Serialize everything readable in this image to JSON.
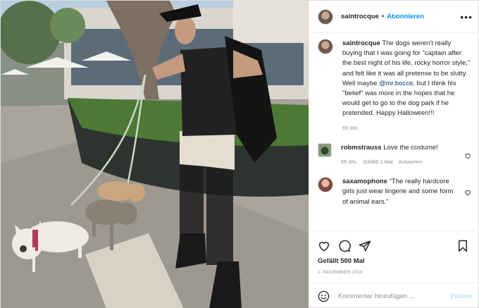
{
  "header": {
    "username": "saintrocque",
    "separator": "•",
    "follow_label": "Abonnieren",
    "more_icon": "more-options-icon"
  },
  "caption": {
    "username": "saintrocque",
    "text_before_mention": " The dogs weren't really buying that I was going for \"captain after the best night of his life, rocky horror style,\" and felt like it was all pretense to be slutty. Well maybe ",
    "mention": "@mr.bocce",
    "text_after_mention": ", but I think his \"belief\" was more in the hopes that he would get to go to the dog park if he pretended. Happy Halloween!!!",
    "time": "69 Wo."
  },
  "comments": [
    {
      "username": "robmstrauss",
      "text": " Love the costume!",
      "time": "69 Wo.",
      "likes": "Gefällt 1 Mal",
      "reply": "Antworten"
    },
    {
      "username": "saxamophone",
      "text": " \"The really hardcore girls just wear lingerie and some form of animal ears.\""
    }
  ],
  "actions": {
    "likes_label": "Gefällt 500 Mal",
    "date": "1. NOVEMBER 2019"
  },
  "add_comment": {
    "placeholder": "Kommentar hinzufügen ...",
    "post_label": "Posten"
  },
  "colors": {
    "link_blue": "#0095f6",
    "muted": "#8e8e8e",
    "border": "#efefef",
    "post_disabled": "#b2dffc"
  }
}
